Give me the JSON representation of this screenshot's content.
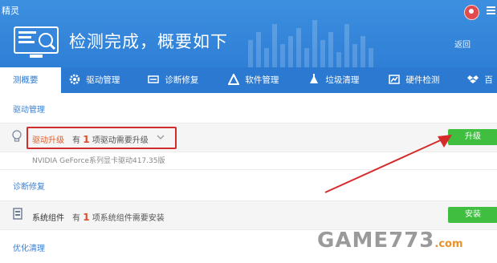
{
  "app": {
    "title": "精灵",
    "headline": "检测完成，概要如下",
    "back": "返回"
  },
  "tabs": [
    {
      "label": "测概要",
      "icon": "none"
    },
    {
      "label": "驱动管理",
      "icon": "gear-icon"
    },
    {
      "label": "诊断修复",
      "icon": "wrench-icon"
    },
    {
      "label": "软件管理",
      "icon": "triangle-icon"
    },
    {
      "label": "垃圾清理",
      "icon": "broom-icon"
    },
    {
      "label": "硬件检测",
      "icon": "chart-icon"
    },
    {
      "label": "百",
      "icon": "dropbox-icon"
    }
  ],
  "sections": {
    "driver": {
      "title": "驱动管理",
      "label": "驱动升级",
      "count_prefix": "有",
      "count": "1",
      "count_suffix": "项驱动需要升级",
      "detail": "NVIDIA GeForce系列显卡驱动417.35版",
      "button": "升级"
    },
    "diagnose": {
      "title": "诊断修复",
      "label": "系统组件",
      "count_prefix": "有",
      "count": "1",
      "count_suffix": "项系统组件需要安装",
      "button": "安装"
    },
    "optimize": {
      "title": "优化清理"
    }
  },
  "watermark": {
    "text": "GAME773",
    "suffix": ".com"
  },
  "colors": {
    "header": "#2e7fd6",
    "tabbar": "#2b79d1",
    "button": "#3fbe3f",
    "highlight": "#d12d2d",
    "link": "#3a7fd3"
  }
}
